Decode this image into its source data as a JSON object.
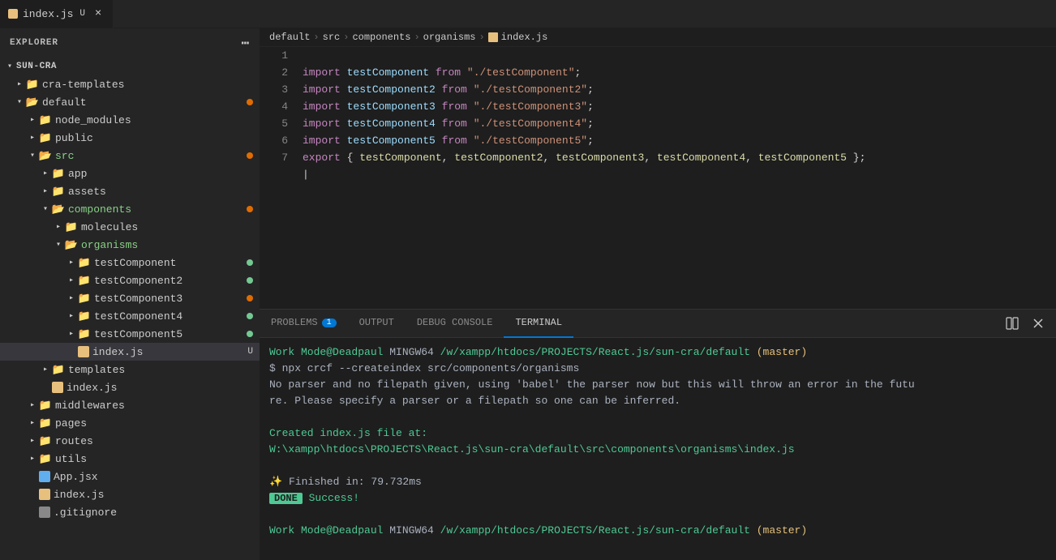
{
  "topbar": {
    "tab_label": "index.js",
    "tab_modified": "U",
    "tab_close": "×"
  },
  "sidebar": {
    "header": "EXPLORER",
    "root": "SUN-CRA",
    "tree": [
      {
        "id": "cra-templates",
        "label": "cra-templates",
        "type": "folder",
        "indent": 1,
        "open": false,
        "color": "cra",
        "dot": null
      },
      {
        "id": "default",
        "label": "default",
        "type": "folder",
        "indent": 1,
        "open": true,
        "color": "default",
        "dot": "orange"
      },
      {
        "id": "node_modules",
        "label": "node_modules",
        "type": "folder",
        "indent": 2,
        "open": false,
        "color": "node",
        "dot": null
      },
      {
        "id": "public",
        "label": "public",
        "type": "folder",
        "indent": 2,
        "open": false,
        "color": "public",
        "dot": null
      },
      {
        "id": "src",
        "label": "src",
        "type": "folder",
        "indent": 2,
        "open": true,
        "color": "src",
        "dot": "orange"
      },
      {
        "id": "app",
        "label": "app",
        "type": "folder",
        "indent": 3,
        "open": false,
        "color": "app",
        "dot": null
      },
      {
        "id": "assets",
        "label": "assets",
        "type": "folder",
        "indent": 3,
        "open": false,
        "color": "assets",
        "dot": null
      },
      {
        "id": "components",
        "label": "components",
        "type": "folder",
        "indent": 3,
        "open": true,
        "color": "components",
        "dot": "orange"
      },
      {
        "id": "molecules",
        "label": "molecules",
        "type": "folder",
        "indent": 4,
        "open": false,
        "color": "molecules",
        "dot": null
      },
      {
        "id": "organisms",
        "label": "organisms",
        "type": "folder",
        "indent": 4,
        "open": true,
        "color": "organisms",
        "dot": null
      },
      {
        "id": "testComponent",
        "label": "testComponent",
        "type": "folder",
        "indent": 5,
        "open": false,
        "color": "app",
        "dot": "green"
      },
      {
        "id": "testComponent2",
        "label": "testComponent2",
        "type": "folder",
        "indent": 5,
        "open": false,
        "color": "app",
        "dot": "green"
      },
      {
        "id": "testComponent3",
        "label": "testComponent3",
        "type": "folder",
        "indent": 5,
        "open": false,
        "color": "app",
        "dot": "orange"
      },
      {
        "id": "testComponent4",
        "label": "testComponent4",
        "type": "folder",
        "indent": 5,
        "open": false,
        "color": "app",
        "dot": "green"
      },
      {
        "id": "testComponent5",
        "label": "testComponent5",
        "type": "folder",
        "indent": 5,
        "open": false,
        "color": "app",
        "dot": "green"
      },
      {
        "id": "index.js-organisms",
        "label": "index.js",
        "type": "file",
        "fileType": "js",
        "indent": 5,
        "open": false,
        "dot": null,
        "badge": "U",
        "selected": true
      },
      {
        "id": "templates",
        "label": "templates",
        "type": "folder",
        "indent": 3,
        "open": false,
        "color": "templates",
        "dot": null
      },
      {
        "id": "index.js-src",
        "label": "index.js",
        "type": "file",
        "fileType": "js",
        "indent": 3,
        "open": false,
        "dot": null,
        "badge": null
      },
      {
        "id": "middlewares",
        "label": "middlewares",
        "type": "folder",
        "indent": 2,
        "open": false,
        "color": "middlewares",
        "dot": null
      },
      {
        "id": "pages",
        "label": "pages",
        "type": "folder",
        "indent": 2,
        "open": false,
        "color": "pages",
        "dot": null
      },
      {
        "id": "routes",
        "label": "routes",
        "type": "folder",
        "indent": 2,
        "open": false,
        "color": "routes",
        "dot": null
      },
      {
        "id": "utils",
        "label": "utils",
        "type": "folder",
        "indent": 2,
        "open": false,
        "color": "utils",
        "dot": null
      },
      {
        "id": "App.jsx",
        "label": "App.jsx",
        "type": "file",
        "fileType": "jsx",
        "indent": 2,
        "open": false,
        "dot": null,
        "badge": null
      },
      {
        "id": "index.js-default",
        "label": "index.js",
        "type": "file",
        "fileType": "js",
        "indent": 2,
        "open": false,
        "dot": null,
        "badge": null
      },
      {
        "id": ".gitignore",
        "label": ".gitignore",
        "type": "file",
        "fileType": "gitignore",
        "indent": 2,
        "open": false,
        "dot": null,
        "badge": null
      }
    ]
  },
  "breadcrumb": {
    "parts": [
      "default",
      "src",
      "components",
      "organisms",
      "index.js"
    ]
  },
  "editor": {
    "lines": [
      {
        "num": 1,
        "tokens": [
          {
            "type": "kw",
            "text": "import "
          },
          {
            "type": "id",
            "text": "testComponent"
          },
          {
            "type": "kw",
            "text": " from "
          },
          {
            "type": "str",
            "text": "\"./testComponent\""
          },
          {
            "type": "punct",
            "text": ";"
          }
        ]
      },
      {
        "num": 2,
        "tokens": [
          {
            "type": "kw",
            "text": "import "
          },
          {
            "type": "id",
            "text": "testComponent2"
          },
          {
            "type": "kw",
            "text": " from "
          },
          {
            "type": "str",
            "text": "\"./testComponent2\""
          },
          {
            "type": "punct",
            "text": ";"
          }
        ]
      },
      {
        "num": 3,
        "tokens": [
          {
            "type": "kw",
            "text": "import "
          },
          {
            "type": "id",
            "text": "testComponent3"
          },
          {
            "type": "kw",
            "text": " from "
          },
          {
            "type": "str",
            "text": "\"./testComponent3\""
          },
          {
            "type": "punct",
            "text": ";"
          }
        ]
      },
      {
        "num": 4,
        "tokens": [
          {
            "type": "kw",
            "text": "import "
          },
          {
            "type": "id",
            "text": "testComponent4"
          },
          {
            "type": "kw",
            "text": " from "
          },
          {
            "type": "str",
            "text": "\"./testComponent4\""
          },
          {
            "type": "punct",
            "text": ";"
          }
        ]
      },
      {
        "num": 5,
        "tokens": [
          {
            "type": "kw",
            "text": "import "
          },
          {
            "type": "id",
            "text": "testComponent5"
          },
          {
            "type": "kw",
            "text": " from "
          },
          {
            "type": "str",
            "text": "\"./testComponent5\""
          },
          {
            "type": "punct",
            "text": ";"
          }
        ]
      },
      {
        "num": 6,
        "tokens": [
          {
            "type": "kw",
            "text": "export "
          },
          {
            "type": "punct",
            "text": "{ "
          },
          {
            "type": "id-orange",
            "text": "testComponent"
          },
          {
            "type": "punct",
            "text": ", "
          },
          {
            "type": "id-orange",
            "text": "testComponent2"
          },
          {
            "type": "punct",
            "text": ", "
          },
          {
            "type": "id-orange",
            "text": "testComponent3"
          },
          {
            "type": "punct",
            "text": ", "
          },
          {
            "type": "id-orange",
            "text": "testComponent4"
          },
          {
            "type": "punct",
            "text": ", "
          },
          {
            "type": "id-orange",
            "text": "testComponent5"
          },
          {
            "type": "punct",
            "text": " };"
          }
        ]
      },
      {
        "num": 7,
        "tokens": []
      }
    ]
  },
  "terminal": {
    "tabs": [
      {
        "label": "PROBLEMS",
        "badge": "1"
      },
      {
        "label": "OUTPUT",
        "badge": null
      },
      {
        "label": "DEBUG CONSOLE",
        "badge": null
      },
      {
        "label": "TERMINAL",
        "badge": null,
        "active": true
      }
    ],
    "lines": [
      {
        "type": "prompt",
        "user": "Work Mode@Deadpaul",
        "shell": "MINGW64",
        "path": "/w/xampp/htdocs/PROJECTS/React.js/sun-cra/default",
        "branch": "(master)"
      },
      {
        "type": "cmd",
        "text": "$ npx crcf --createindex src/components/organisms"
      },
      {
        "type": "warn",
        "text": "No parser and no filepath given, using 'babel' the parser now but this will throw an error in the futu"
      },
      {
        "type": "warn2",
        "text": "re. Please specify a parser or a filepath so one can be inferred."
      },
      {
        "type": "blank"
      },
      {
        "type": "info",
        "text": "Created index.js file at:"
      },
      {
        "type": "info2",
        "text": "W:\\xampp\\htdocs\\PROJECTS\\React.js\\sun-cra\\default\\src\\components\\organisms\\index.js"
      },
      {
        "type": "blank"
      },
      {
        "type": "finish",
        "icon": "✨",
        "time": "Finished in: 79.732ms"
      },
      {
        "type": "done",
        "badge": "DONE",
        "text": "Success!"
      },
      {
        "type": "blank"
      },
      {
        "type": "prompt2",
        "user": "Work Mode@Deadpaul",
        "shell": "MINGW64",
        "path": "/w/xampp/htdocs/PROJECTS/React.js/sun-cra/default",
        "branch": "(master)"
      }
    ]
  }
}
